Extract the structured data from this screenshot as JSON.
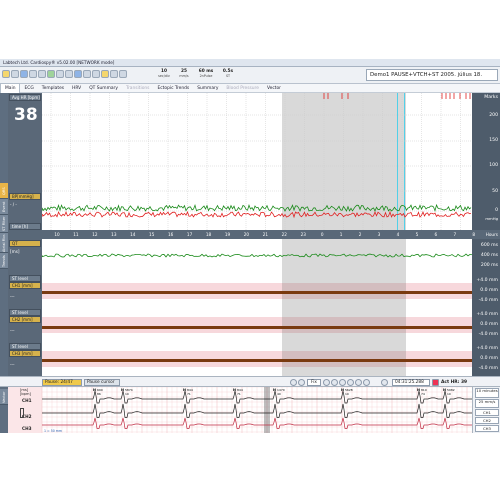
{
  "app": {
    "title": "Labtech Ltd. Cardiospy® v5.02.00 [NETWORK mode]"
  },
  "toolbar": {
    "speeds": [
      {
        "value": "10",
        "unit": "sec/div"
      },
      {
        "value": "25",
        "unit": "mm/s"
      },
      {
        "value": "60 ms",
        "unit": "2nPulse"
      },
      {
        "value": "0.5s",
        "unit": "ST"
      }
    ],
    "patient_text": "Demo1 PAUSE+VTCH+ST  2005. július 18."
  },
  "menu": {
    "tabs": [
      "Main",
      "ECG",
      "Templates",
      "HRV",
      "QT Summary",
      "Transitions",
      "Ectopic Trends",
      "Summary",
      "Blood Pressure",
      "Vector"
    ],
    "active": 0
  },
  "left_strip": {
    "tabs": [
      "QRS",
      "Event",
      "ST Filter",
      "Atrial Fibr.",
      "Trends",
      "Vector"
    ]
  },
  "hr_panel": {
    "label": "Avg HR [bpm]",
    "value": "38",
    "bp_label": "BP[mmHg]",
    "bp_value": "- / -",
    "time_label": "time [h]"
  },
  "right_scale": {
    "top": [
      "Marks",
      "200",
      "150",
      "100",
      "50",
      "0",
      "mmHg"
    ],
    "hours": "Hours"
  },
  "time_axis": {
    "ticks": [
      "10",
      "11",
      "12",
      "13",
      "14",
      "15",
      "16",
      "17",
      "18",
      "19",
      "20",
      "21",
      "22",
      "23",
      "0",
      "1",
      "2",
      "3",
      "4",
      "5",
      "6",
      "7",
      "8"
    ]
  },
  "qt_panel": {
    "label": "QT",
    "sub": "[ms]",
    "scale": [
      "600 ms",
      "400 ms",
      "200 ms"
    ]
  },
  "st_panels": [
    {
      "label": "ST level",
      "ch": "CH1 [mm]",
      "value": "---",
      "scale": [
        "+4.0 mm",
        "0.0 mm",
        "-4.0 mm"
      ]
    },
    {
      "label": "ST level",
      "ch": "CH2 [mm]",
      "value": "---",
      "scale": [
        "+4.0 mm",
        "0.0 mm",
        "-4.0 mm"
      ]
    },
    {
      "label": "ST level",
      "ch": "CH3 [mm]",
      "value": "---",
      "scale": [
        "+4.0 mm",
        "0.0 mm",
        "-4.0 mm"
      ]
    }
  ],
  "control_bar": {
    "event": "Pause: 24/47",
    "mode": "Pause cursor",
    "zoom": "Fix",
    "time": "04:31:25.288",
    "act_hr": "Act HR: 39"
  },
  "ecg": {
    "info": "[ms]\n[bpm]",
    "channels": [
      "CH1",
      "CH2",
      "CH3"
    ],
    "scale": "1 = 50 mm",
    "beat_labels": [
      {
        "t": "N",
        "v": "690\n86"
      },
      {
        "t": "N",
        "v": "5874\n10"
      },
      {
        "t": "N",
        "v": "844\n71"
      },
      {
        "t": "N",
        "v": "844\n71"
      },
      {
        "t": "N",
        "v": "1470\n40"
      },
      {
        "t": "N",
        "v": "5628\n10"
      },
      {
        "t": "N",
        "v": "810\n74"
      },
      {
        "t": "N",
        "v": "5982\n10"
      }
    ],
    "right_buttons": [
      "10 minutes",
      "25 mm/s",
      "CH1",
      "CH2",
      "CH3",
      "Median 25 mm/s"
    ]
  },
  "colors": {
    "accent": "#e8b448",
    "hr_line": "#1a8a1a",
    "bp_line": "#e02020",
    "st_bg": "#f7d8dc",
    "cursor": "#52d0e8"
  }
}
